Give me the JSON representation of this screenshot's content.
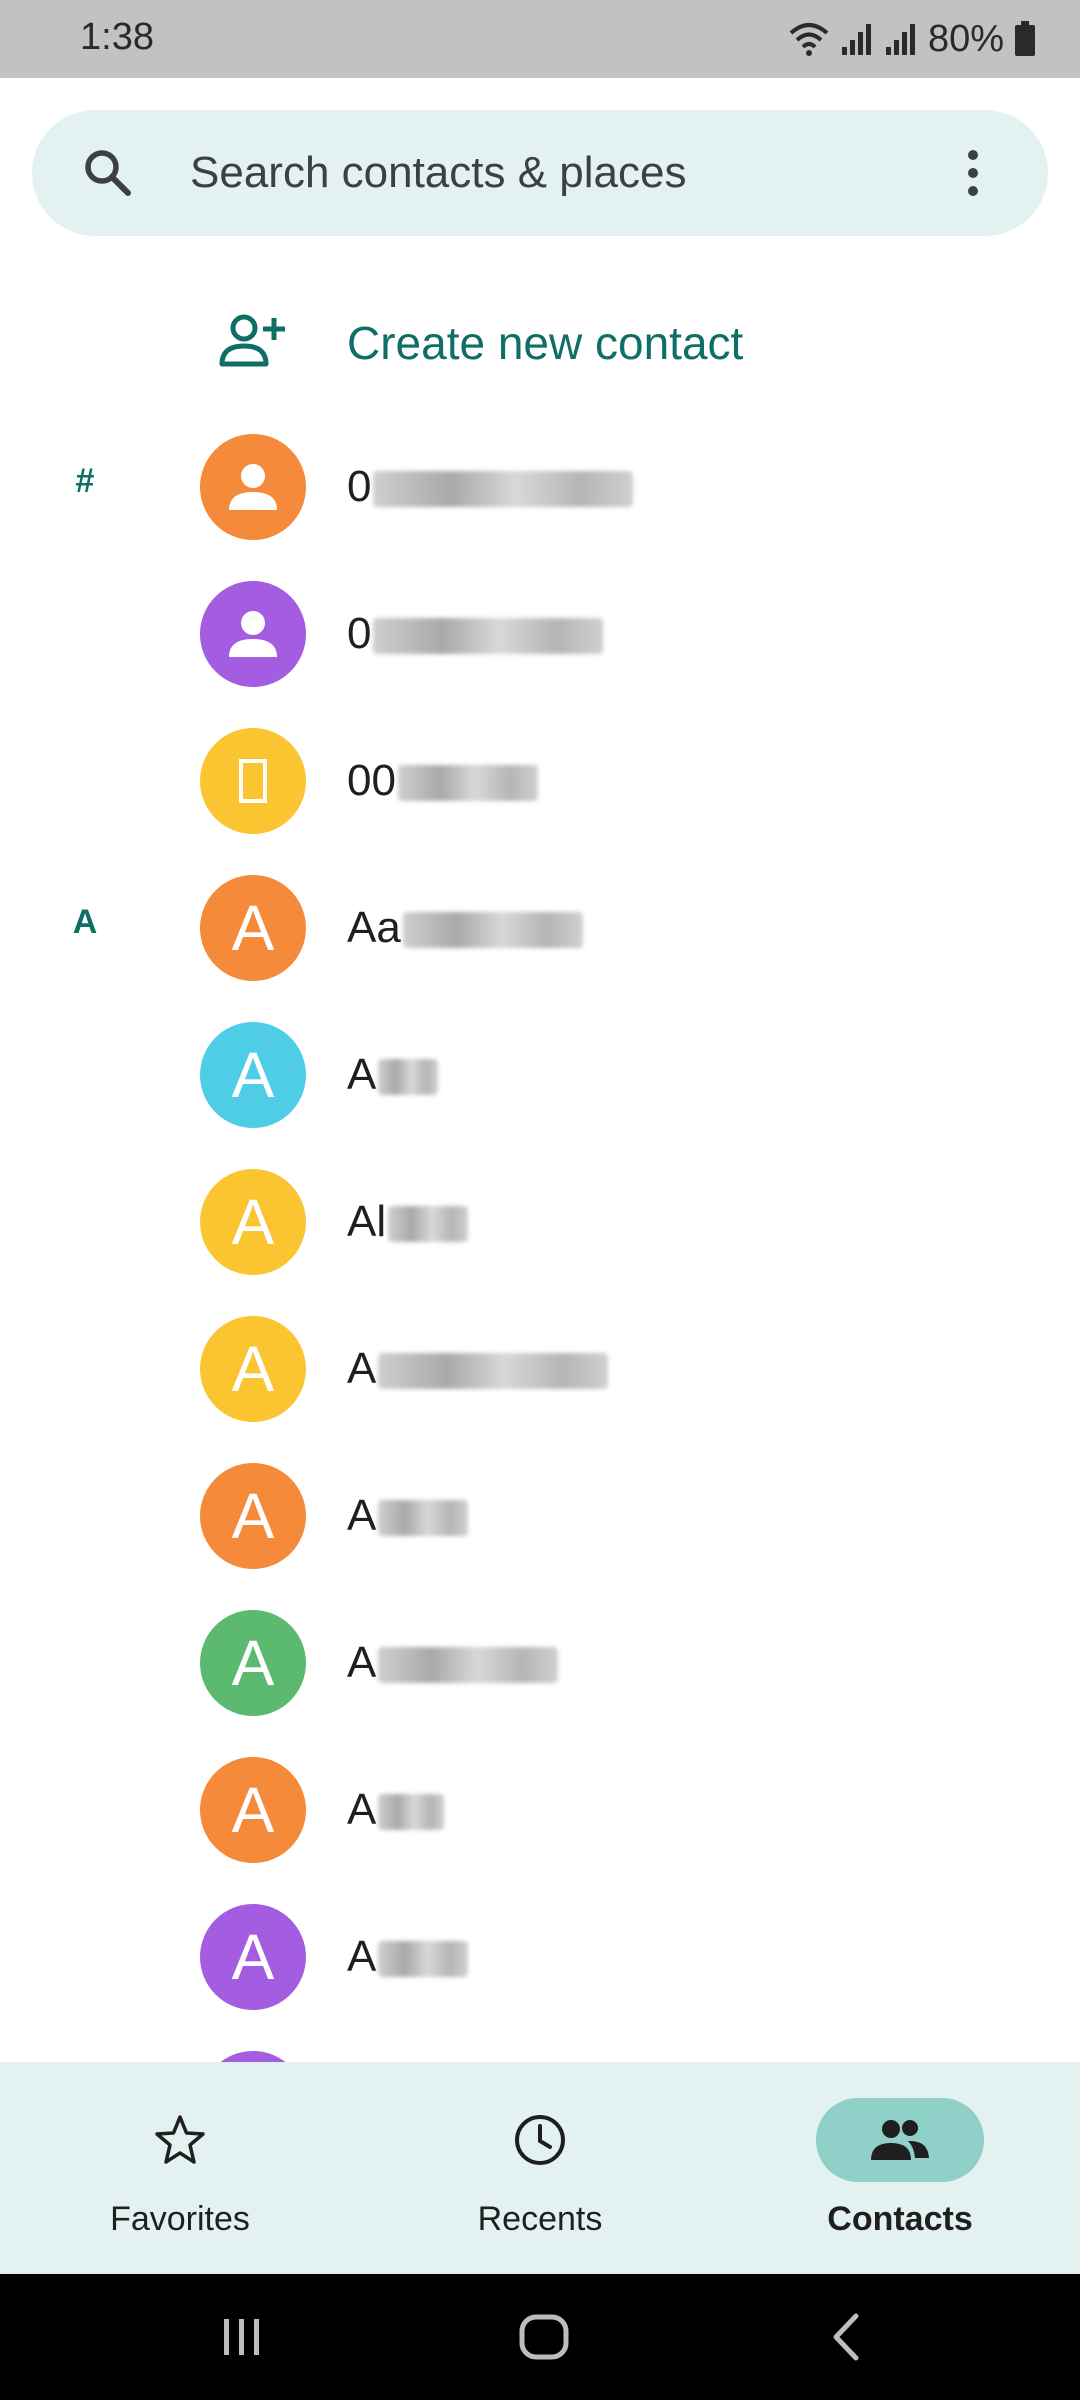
{
  "status_bar": {
    "time": "1:38",
    "battery_percent": "80%",
    "icons": [
      "wifi-icon",
      "signal-icon",
      "signal-icon",
      "battery-icon"
    ]
  },
  "search": {
    "placeholder": "Search contacts & places",
    "icon": "search-icon",
    "menu_icon": "more-vert-icon"
  },
  "create_contact": {
    "label": "Create new contact",
    "icon": "add-person-icon"
  },
  "colors": {
    "accent": "#0f6e66",
    "search_bg": "#e3f2f1",
    "nav_active_pill": "#8fd0c8",
    "avatar_orange": "#f48a3a",
    "avatar_purple": "#a45ce0",
    "avatar_yellow": "#fbc531",
    "avatar_cyan": "#4fcde6",
    "avatar_green": "#5cba70"
  },
  "contacts": [
    {
      "section": "#",
      "avatar_letter": "",
      "avatar_type": "person",
      "color": "#f48a3a",
      "name": "0"
    },
    {
      "section": "",
      "avatar_letter": "",
      "avatar_type": "person",
      "color": "#a45ce0",
      "name": "0"
    },
    {
      "section": "",
      "avatar_letter": "",
      "avatar_type": "box",
      "color": "#fbc531",
      "name": "00"
    },
    {
      "section": "A",
      "avatar_letter": "A",
      "avatar_type": "letter",
      "color": "#f48a3a",
      "name": "Aa"
    },
    {
      "section": "",
      "avatar_letter": "A",
      "avatar_type": "letter",
      "color": "#4fcde6",
      "name": "A"
    },
    {
      "section": "",
      "avatar_letter": "A",
      "avatar_type": "letter",
      "color": "#fbc531",
      "name": "Al"
    },
    {
      "section": "",
      "avatar_letter": "A",
      "avatar_type": "letter",
      "color": "#fbc531",
      "name": "A"
    },
    {
      "section": "",
      "avatar_letter": "A",
      "avatar_type": "letter",
      "color": "#f48a3a",
      "name": "A"
    },
    {
      "section": "",
      "avatar_letter": "A",
      "avatar_type": "letter",
      "color": "#5cba70",
      "name": "A"
    },
    {
      "section": "",
      "avatar_letter": "A",
      "avatar_type": "letter",
      "color": "#f48a3a",
      "name": "A"
    },
    {
      "section": "",
      "avatar_letter": "A",
      "avatar_type": "letter",
      "color": "#a45ce0",
      "name": "A"
    },
    {
      "section": "",
      "avatar_letter": "",
      "avatar_type": "letter",
      "color": "#a45ce0",
      "name": ""
    }
  ],
  "bottom_nav": {
    "items": [
      {
        "label": "Favorites",
        "icon": "star-icon",
        "active": false
      },
      {
        "label": "Recents",
        "icon": "clock-icon",
        "active": false
      },
      {
        "label": "Contacts",
        "icon": "people-icon",
        "active": true
      }
    ]
  },
  "system_nav": {
    "buttons": [
      "recents-icon",
      "home-icon",
      "back-icon"
    ]
  }
}
